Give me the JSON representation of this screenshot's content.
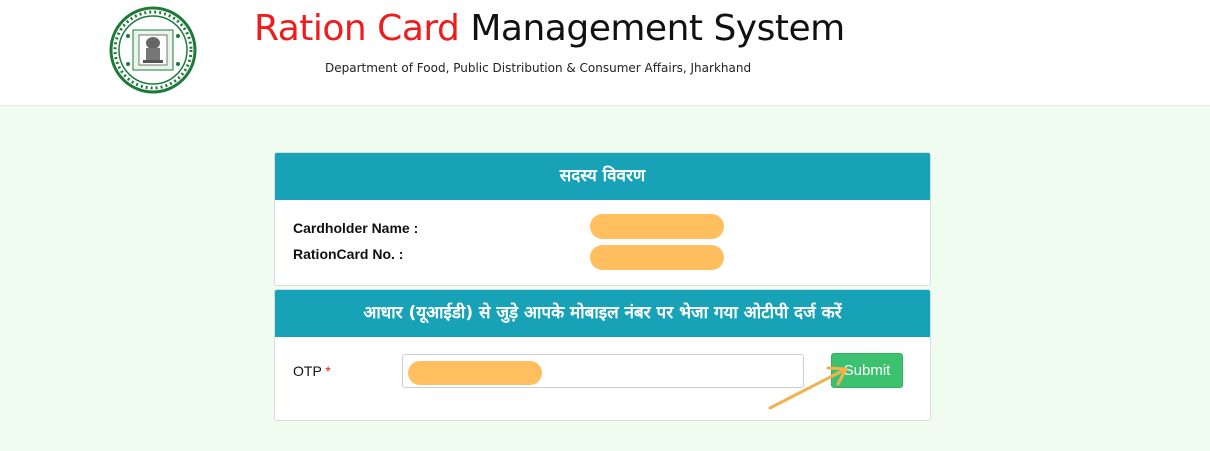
{
  "header": {
    "title_part1": "Ration Card",
    "title_part2": "Management System",
    "subtitle": "Department of Food, Public Distribution & Consumer Affairs, Jharkhand"
  },
  "member_section": {
    "heading": "सदस्य विवरण",
    "cardholder_label": "Cardholder Name :",
    "rationcard_label": "RationCard No. :"
  },
  "otp_section": {
    "heading": "आधार (यूआईडी) से जुड़े आपके मोबाइल नंबर पर भेजा गया ओटीपी दर्ज करें",
    "otp_label": "OTP",
    "required_mark": "*",
    "otp_value": "",
    "submit_label": "Submit"
  },
  "colors": {
    "header_teal": "#17a2b8",
    "title_red": "#ee1c1c",
    "submit_green": "#3cc26e",
    "redaction_orange": "#ffbf5e",
    "page_bg": "#f1fcf1"
  },
  "icons": {
    "emblem": "government-of-jharkhand-emblem-icon",
    "annotation": "arrow-annotation-icon"
  }
}
